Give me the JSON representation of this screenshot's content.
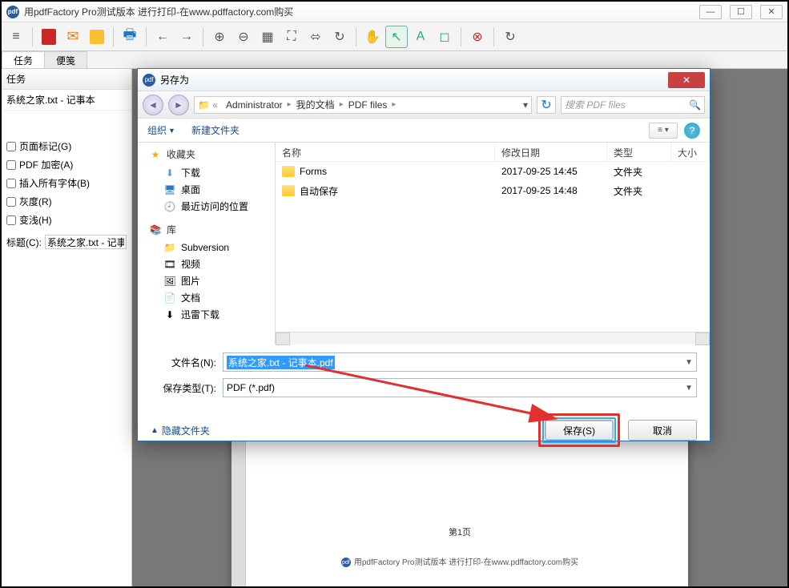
{
  "main_window": {
    "title": "用pdfFactory Pro测试版本 进行打印-在www.pdffactory.com购买"
  },
  "tabs": {
    "tasks": "任务",
    "notes": "便笺"
  },
  "left_panel": {
    "header": "任务",
    "doc_item": "系统之家.txt - 记事本",
    "checks": {
      "page_marks": "页面标记(G)",
      "pdf_encrypt": "PDF 加密(A)",
      "embed_fonts": "插入所有字体(B)",
      "grayscale": "灰度(R)",
      "invert": "变浅(H)"
    },
    "title_label": "标题(C):",
    "title_value": "系统之家.txt - 记事"
  },
  "preview": {
    "page_number": "第1页",
    "footer": "用pdfFactory Pro测试版本 进行打印-在www.pdffactory.com购买"
  },
  "dialog": {
    "title": "另存为",
    "breadcrumb": {
      "seg1": "Administrator",
      "seg2": "我的文档",
      "seg3": "PDF files"
    },
    "search_placeholder": "搜索 PDF files",
    "toolbar": {
      "organize": "组织",
      "new_folder": "新建文件夹"
    },
    "tree": {
      "favorites": "收藏夹",
      "downloads": "下载",
      "desktop": "桌面",
      "recent": "最近访问的位置",
      "library": "库",
      "subversion": "Subversion",
      "video": "视频",
      "pictures": "图片",
      "documents": "文档",
      "thunder": "迅雷下载"
    },
    "columns": {
      "name": "名称",
      "date": "修改日期",
      "type": "类型",
      "size": "大小"
    },
    "files": [
      {
        "name": "Forms",
        "date": "2017-09-25 14:45",
        "type": "文件夹"
      },
      {
        "name": "自动保存",
        "date": "2017-09-25 14:48",
        "type": "文件夹"
      }
    ],
    "filename_label": "文件名(N):",
    "filename_value": "系统之家.txt - 记事本.pdf",
    "filetype_label": "保存类型(T):",
    "filetype_value": "PDF (*.pdf)",
    "hide_folders": "隐藏文件夹",
    "save_btn": "保存(S)",
    "cancel_btn": "取消"
  }
}
